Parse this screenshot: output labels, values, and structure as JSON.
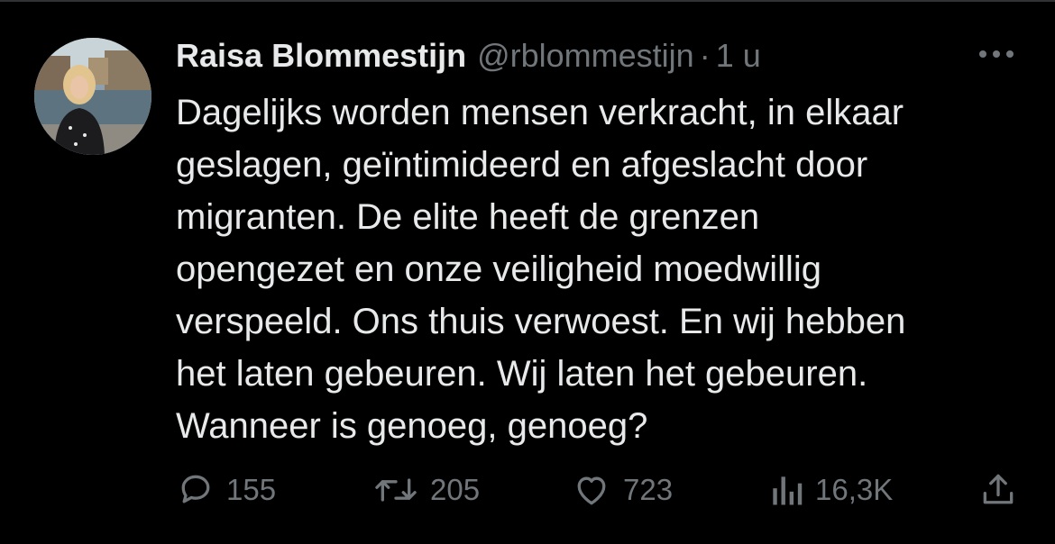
{
  "tweet": {
    "author": {
      "display_name": "Raisa Blommestijn",
      "handle": "@rblommestijn",
      "separator": "·",
      "timestamp": "1 u"
    },
    "text": "Dagelijks worden mensen verkracht, in elkaar\ngeslagen, geïntimideerd en afgeslacht door\nmigranten. De elite heeft de grenzen\nopengezet en onze veiligheid moedwillig\nverspeeld. Ons thuis verwoest. En wij hebben\nhet laten gebeuren. Wij laten het gebeuren.\nWanneer is genoeg, genoeg?",
    "stats": {
      "replies": "155",
      "retweets": "205",
      "likes": "723",
      "views": "16,3K"
    }
  },
  "icons": {
    "more": "more-horizontal-icon",
    "reply": "reply-bubble-icon",
    "retweet": "retweet-icon",
    "like": "heart-icon",
    "views": "views-bar-chart-icon",
    "share": "share-upload-icon"
  },
  "colors": {
    "background": "#000000",
    "text_primary": "#e7e9ea",
    "text_secondary": "#71767b",
    "divider": "#2f3336"
  }
}
